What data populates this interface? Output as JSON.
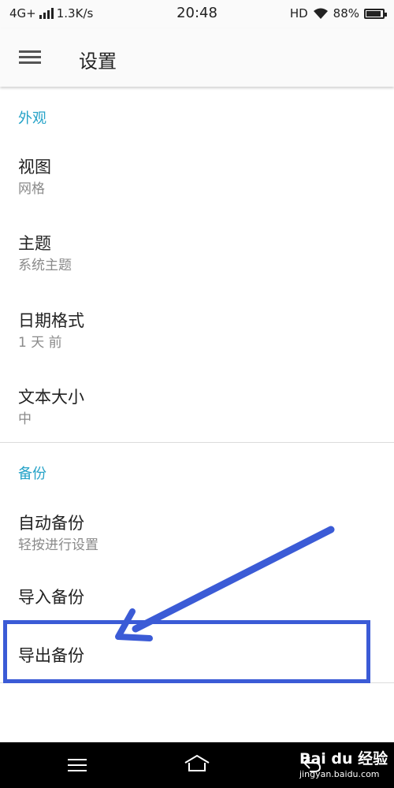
{
  "status_bar": {
    "network": "4G+",
    "speed": "1.3K/s",
    "time": "20:48",
    "hd": "HD",
    "battery": "88%"
  },
  "app_bar": {
    "title": "设置",
    "menu_icon": "hamburger-menu-icon"
  },
  "sections": {
    "appearance": {
      "header": "外观",
      "items": [
        {
          "title": "视图",
          "summary": "网格"
        },
        {
          "title": "主题",
          "summary": "系统主题"
        },
        {
          "title": "日期格式",
          "summary": "1 天 前"
        },
        {
          "title": "文本大小",
          "summary": "中"
        }
      ]
    },
    "backup": {
      "header": "备份",
      "items": [
        {
          "title": "自动备份",
          "summary": "轻按进行设置"
        },
        {
          "title": "导入备份"
        },
        {
          "title": "导出备份"
        }
      ]
    }
  },
  "annotation": {
    "color": "#3b5bd6",
    "highlighted_item": "导出备份"
  },
  "accent_color": "#26a3c8",
  "nav_bar": {
    "icons": [
      "menu-icon",
      "home-icon",
      "back-icon"
    ]
  },
  "watermark": {
    "main": "Bai du 经验",
    "sub": "jingyan.baidu.com"
  }
}
